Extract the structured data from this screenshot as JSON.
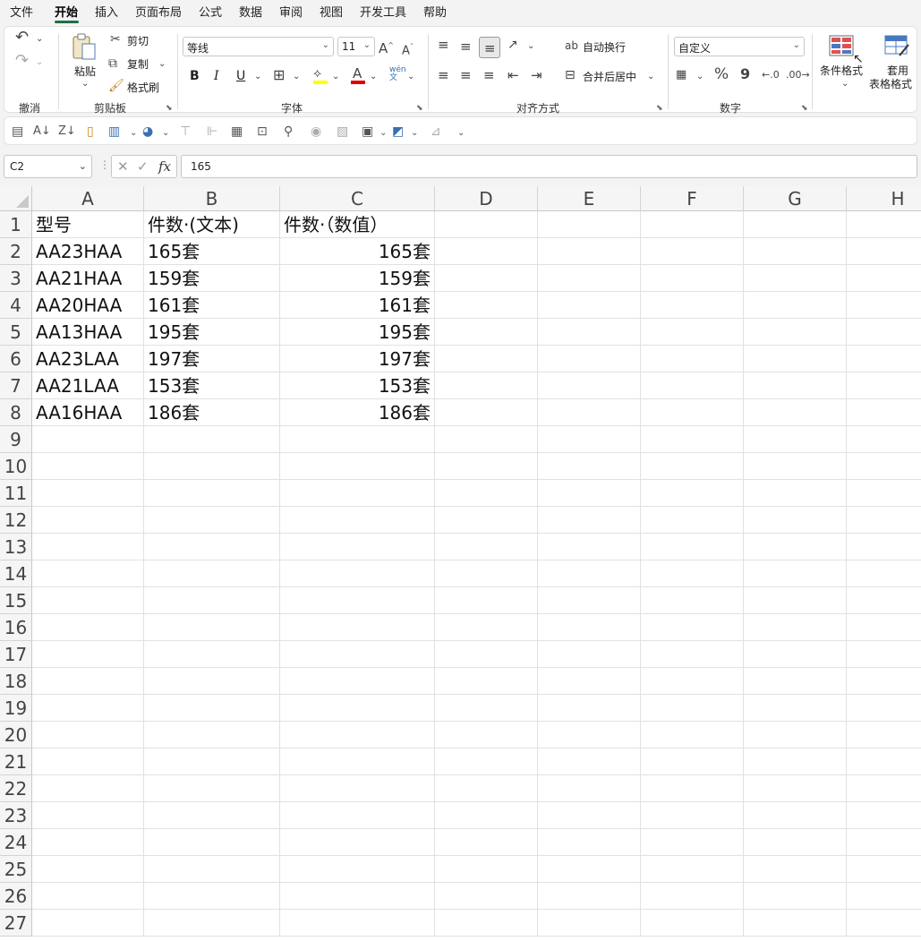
{
  "menu": {
    "items": [
      "文件",
      "开始",
      "插入",
      "页面布局",
      "公式",
      "数据",
      "审阅",
      "视图",
      "开发工具",
      "帮助"
    ],
    "active": "开始"
  },
  "ribbon": {
    "undo_group": "撤消",
    "clipboard": {
      "paste": "粘贴",
      "cut": "剪切",
      "copy": "复制",
      "painter": "格式刷",
      "group": "剪贴板"
    },
    "font": {
      "name": "等线",
      "size": "11",
      "bold": "B",
      "italic": "I",
      "underline": "U",
      "group": "字体"
    },
    "alignment": {
      "wrap": "自动换行",
      "merge": "合并后居中",
      "group": "对齐方式"
    },
    "number": {
      "format": "自定义",
      "percent": "%",
      "comma": "9",
      "group": "数字"
    },
    "styles": {
      "conditional": "条件格式",
      "table_format_1": "套用",
      "table_format_2": "表格格式"
    }
  },
  "formula_bar": {
    "name_box": "C2",
    "fx": "fx",
    "value": "165"
  },
  "sheet": {
    "columns": [
      "A",
      "B",
      "C",
      "D",
      "E",
      "F",
      "G",
      "H"
    ],
    "rows": [
      "1",
      "2",
      "3",
      "4",
      "5",
      "6",
      "7",
      "8",
      "9",
      "10",
      "11",
      "12",
      "13",
      "14",
      "15",
      "16",
      "17",
      "18",
      "19",
      "20",
      "21",
      "22",
      "23",
      "24",
      "25",
      "26",
      "27"
    ],
    "header": {
      "a": "型号",
      "b": "件数·(文本)",
      "c": "件数·（数值）"
    },
    "data": [
      {
        "a": "AA23HAA",
        "b": "165套",
        "c": "165套"
      },
      {
        "a": "AA21HAA",
        "b": "159套",
        "c": "159套"
      },
      {
        "a": "AA20HAA",
        "b": "161套",
        "c": "161套"
      },
      {
        "a": "AA13HAA",
        "b": "195套",
        "c": "195套"
      },
      {
        "a": "AA23LAA",
        "b": "197套",
        "c": "197套"
      },
      {
        "a": "AA21LAA",
        "b": "153套",
        "c": "153套"
      },
      {
        "a": "AA16HAA",
        "b": "186套",
        "c": "186套"
      }
    ]
  },
  "colors": {
    "accent": "#1e7145",
    "fill_highlight": "#ffff00",
    "font_red": "#e00000",
    "grid": "#e1e1e1"
  }
}
